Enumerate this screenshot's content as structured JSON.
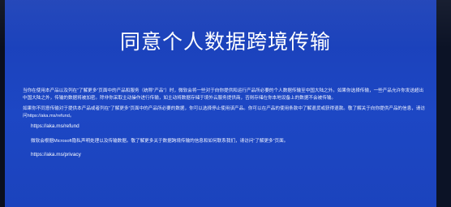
{
  "screen": {
    "background": "#1d47c4",
    "text_color": "#f4f6ff"
  },
  "title": "同意个人数据跨境传输",
  "paragraphs": [
    "当你在使用本产品以及列在“了解更多”页面中的产品和服务（统称“产品”）时，微软会将一些对于向你提供和运行产品所必要的个人数据传输至中国大陆之外。如果你选择传输，一些产品允许你发送超出中国大陆之外，传输的数据将被加密。除非你采取主动操作进行传输，如主动将数据存储于境外云服务提供商，否则存储在你本地设备上的数据不会被传输。",
    "如果你不同意传输对于提供本产品或者列在“了解更多”页面中的产品所必要的数据，你可以选择停止使用该产品。你可以在产品的使用条款中了解退货或获得退款。敬了解关于向你提供产品的信息，请访问https://aka.ms/refund。"
  ],
  "link1": "https://aka.ms/refund",
  "privacy_text": "微软会根据Microsoft隐私声明处理以及传输数据。敬了解更多关于数据跨境传输的信息和如何联系我们，请访问“了解更多”页面。",
  "link2": "https://aka.ms/privacy"
}
